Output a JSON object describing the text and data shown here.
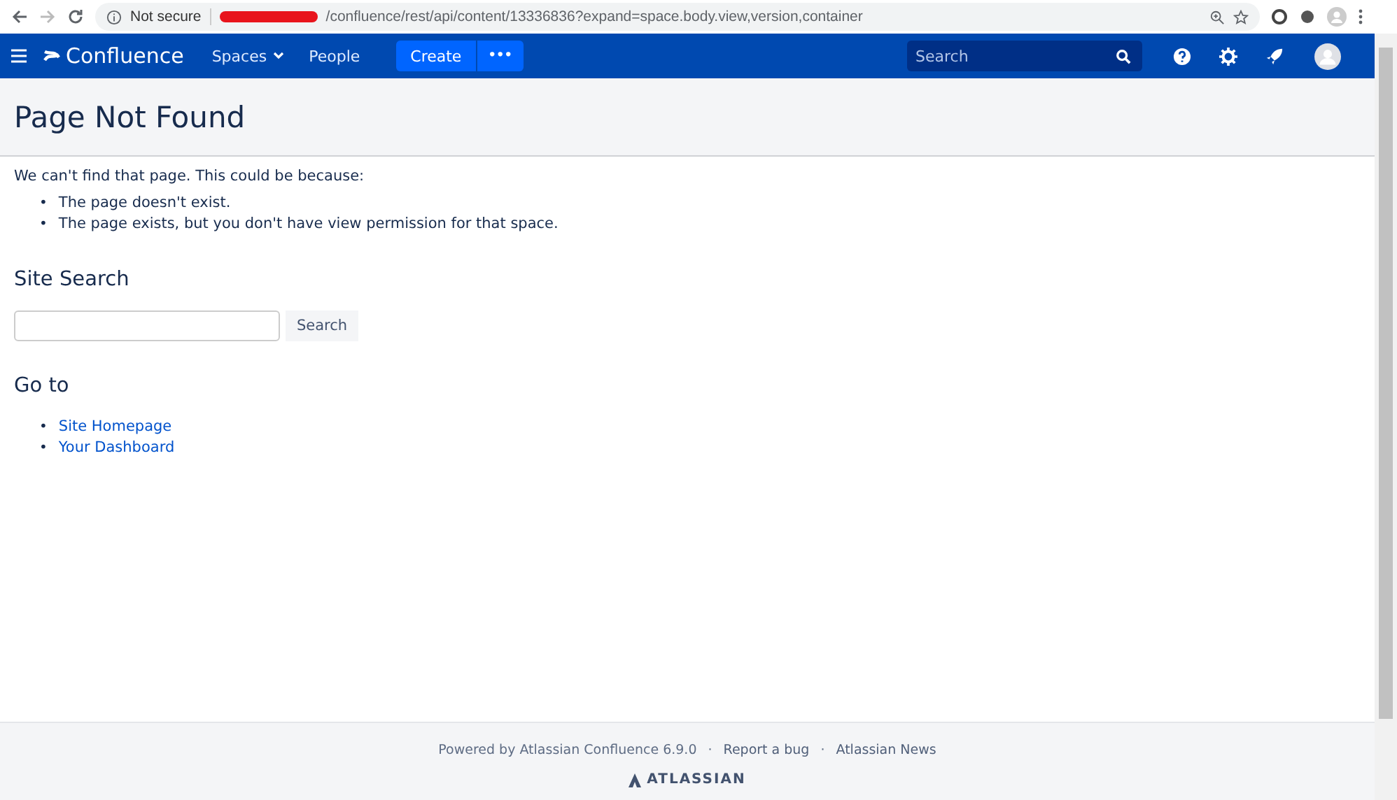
{
  "browser": {
    "security_label": "Not secure",
    "url": "/confluence/rest/api/content/13336836?expand=space.body.view,version,container"
  },
  "nav": {
    "logo": "Confluence",
    "items": [
      {
        "label": "Spaces",
        "dropdown": true
      },
      {
        "label": "People",
        "dropdown": false
      }
    ],
    "create": "Create",
    "more": "•••",
    "search_placeholder": "Search"
  },
  "page": {
    "title": "Page Not Found",
    "intro": "We can't find that page. This could be because:",
    "reasons": [
      {
        "bullet": "•",
        "text": "The page doesn't exist."
      },
      {
        "bullet": "•",
        "text": "The page exists, but you don't have view permission for that space."
      }
    ],
    "site_search": {
      "heading": "Site Search",
      "button": "Search"
    },
    "go_to": {
      "heading": "Go to",
      "links": [
        {
          "bullet": "•",
          "text": "Site Homepage"
        },
        {
          "bullet": "•",
          "text": "Your Dashboard"
        }
      ]
    }
  },
  "footer": {
    "items": [
      {
        "kind": "text",
        "label": "Powered by Atlassian Confluence 6.9.0"
      },
      {
        "kind": "separator",
        "label": "·"
      },
      {
        "kind": "link",
        "label": "Report a bug"
      },
      {
        "kind": "separator",
        "label": "·"
      },
      {
        "kind": "link",
        "label": "Atlassian News"
      }
    ],
    "brand": "ATLASSIAN"
  }
}
